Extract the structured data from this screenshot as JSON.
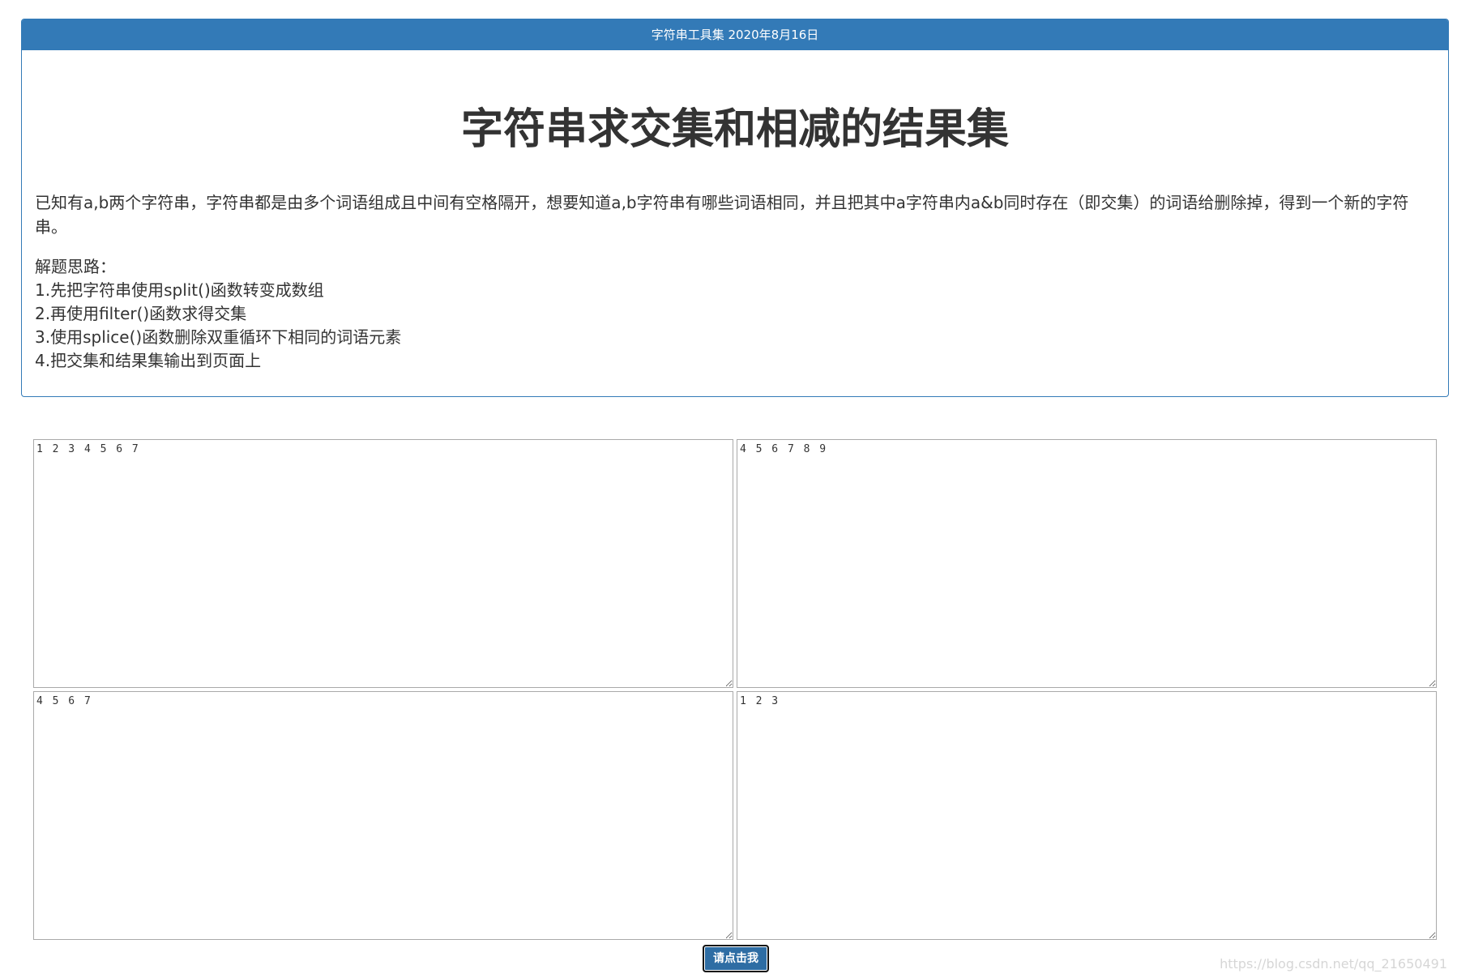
{
  "header": {
    "title": "字符串工具集 2020年8月16日"
  },
  "main": {
    "heading": "字符串求交集和相减的结果集",
    "intro": "已知有a,b两个字符串，字符串都是由多个词语组成且中间有空格隔开，想要知道a,b字符串有哪些词语相同，并且把其中a字符串内a&b同时存在（即交集）的词语给删除掉，得到一个新的字符串。",
    "steps_title": "解题思路：",
    "steps": [
      "1.先把字符串使用split()函数转变成数组",
      "2.再使用filter()函数求得交集",
      "3.使用splice()函数删除双重循环下相同的词语元素",
      "4.把交集和结果集输出到页面上"
    ]
  },
  "inputs": {
    "string_a": "1 2 3 4 5 6 7",
    "string_b": "4 5 6 7 8 9",
    "intersection": "4 5 6 7",
    "result": "1 2 3"
  },
  "button": {
    "label": "请点击我"
  },
  "watermark": "https://blog.csdn.net/qq_21650491",
  "colors": {
    "primary": "#337ab7",
    "button": "#2e6da4"
  }
}
